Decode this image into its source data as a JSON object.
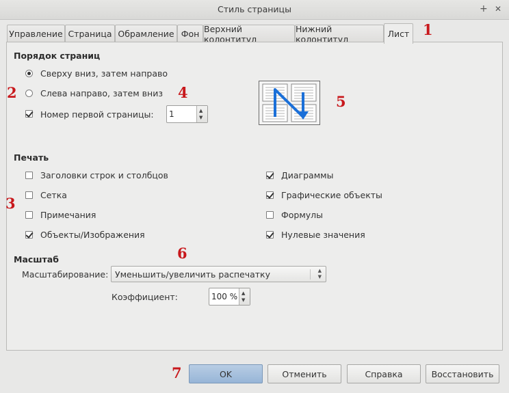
{
  "window": {
    "title": "Стиль страницы",
    "pin_glyph": "+",
    "close_glyph": "✕"
  },
  "tabs": [
    {
      "label": "Управление",
      "active": false
    },
    {
      "label": "Страница",
      "active": false
    },
    {
      "label": "Обрамление",
      "active": false
    },
    {
      "label": "Фон",
      "active": false
    },
    {
      "label": "Верхний колонтитул",
      "active": false
    },
    {
      "label": "Нижний колонтитул",
      "active": false
    },
    {
      "label": "Лист",
      "active": true
    }
  ],
  "page_order": {
    "heading": "Порядок страниц",
    "top_down_label": "Сверху вниз, затем направо",
    "top_down_selected": true,
    "left_right_label": "Слева направо, затем вниз",
    "left_right_selected": false,
    "first_page_label": "Номер первой страницы:",
    "first_page_checked": true,
    "first_page_value": "1",
    "preview_icon": "page-order-preview-icon"
  },
  "print": {
    "heading": "Печать",
    "left": [
      {
        "label": "Заголовки строк и столбцов",
        "checked": false
      },
      {
        "label": "Сетка",
        "checked": false
      },
      {
        "label": "Примечания",
        "checked": false
      },
      {
        "label": "Объекты/Изображения",
        "checked": true
      }
    ],
    "right": [
      {
        "label": "Диаграммы",
        "checked": true
      },
      {
        "label": "Графические объекты",
        "checked": true
      },
      {
        "label": "Формулы",
        "checked": false
      },
      {
        "label": "Нулевые значения",
        "checked": true
      }
    ]
  },
  "scale": {
    "heading": "Масштаб",
    "mode_label": "Масштабирование:",
    "mode_value": "Уменьшить/увеличить распечатку",
    "factor_label": "Коэффициент:",
    "factor_value": "100 %"
  },
  "buttons": {
    "ok": "OK",
    "cancel": "Отменить",
    "help": "Справка",
    "reset": "Восстановить"
  },
  "annotations": [
    "1",
    "2",
    "3",
    "4",
    "5",
    "6",
    "7"
  ],
  "colors": {
    "annotation": "#c8181c",
    "primary_button": "#a9c2e0",
    "arrow": "#1a6fd8"
  }
}
